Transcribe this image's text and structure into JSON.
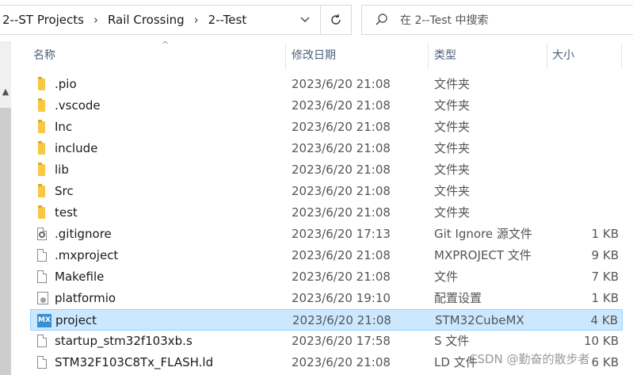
{
  "breadcrumb": {
    "items": [
      "2--ST Projects",
      "Rail Crossing",
      "2--Test"
    ]
  },
  "search": {
    "placeholder": "在 2--Test 中搜索"
  },
  "columns": {
    "name": "名称",
    "date": "修改日期",
    "type": "类型",
    "size": "大小"
  },
  "files": [
    {
      "name": ".pio",
      "date": "2023/6/20 21:08",
      "type": "文件夹",
      "size": "",
      "icon": "folder-icon"
    },
    {
      "name": ".vscode",
      "date": "2023/6/20 21:08",
      "type": "文件夹",
      "size": "",
      "icon": "folder-icon"
    },
    {
      "name": "Inc",
      "date": "2023/6/20 21:08",
      "type": "文件夹",
      "size": "",
      "icon": "folder-icon"
    },
    {
      "name": "include",
      "date": "2023/6/20 21:08",
      "type": "文件夹",
      "size": "",
      "icon": "folder-icon"
    },
    {
      "name": "lib",
      "date": "2023/6/20 21:08",
      "type": "文件夹",
      "size": "",
      "icon": "folder-icon"
    },
    {
      "name": "Src",
      "date": "2023/6/20 21:08",
      "type": "文件夹",
      "size": "",
      "icon": "folder-icon"
    },
    {
      "name": "test",
      "date": "2023/6/20 21:08",
      "type": "文件夹",
      "size": "",
      "icon": "folder-icon"
    },
    {
      "name": ".gitignore",
      "date": "2023/6/20 17:13",
      "type": "Git Ignore 源文件",
      "size": "1 KB",
      "icon": "settings-file-icon"
    },
    {
      "name": ".mxproject",
      "date": "2023/6/20 21:08",
      "type": "MXPROJECT 文件",
      "size": "9 KB",
      "icon": "file-icon"
    },
    {
      "name": "Makefile",
      "date": "2023/6/20 21:08",
      "type": "文件",
      "size": "7 KB",
      "icon": "file-icon"
    },
    {
      "name": "platformio",
      "date": "2023/6/20 19:10",
      "type": "配置设置",
      "size": "1 KB",
      "icon": "config-file-icon"
    },
    {
      "name": "project",
      "date": "2023/6/20 21:08",
      "type": "STM32CubeMX",
      "size": "4 KB",
      "icon": "stm32cubemx-icon",
      "selected": true
    },
    {
      "name": "startup_stm32f103xb.s",
      "date": "2023/6/20 17:58",
      "type": "S 文件",
      "size": "10 KB",
      "icon": "file-icon"
    },
    {
      "name": "STM32F103C8Tx_FLASH.ld",
      "date": "2023/6/20 21:08",
      "type": "LD 文件",
      "size": "6 KB",
      "icon": "file-icon"
    }
  ],
  "mx_badge": "MX",
  "watermark": "CSDN @勤奋的散步者",
  "colors": {
    "selection": "#cce8ff",
    "folder": "#f8c843",
    "header_text": "#4c607a"
  }
}
